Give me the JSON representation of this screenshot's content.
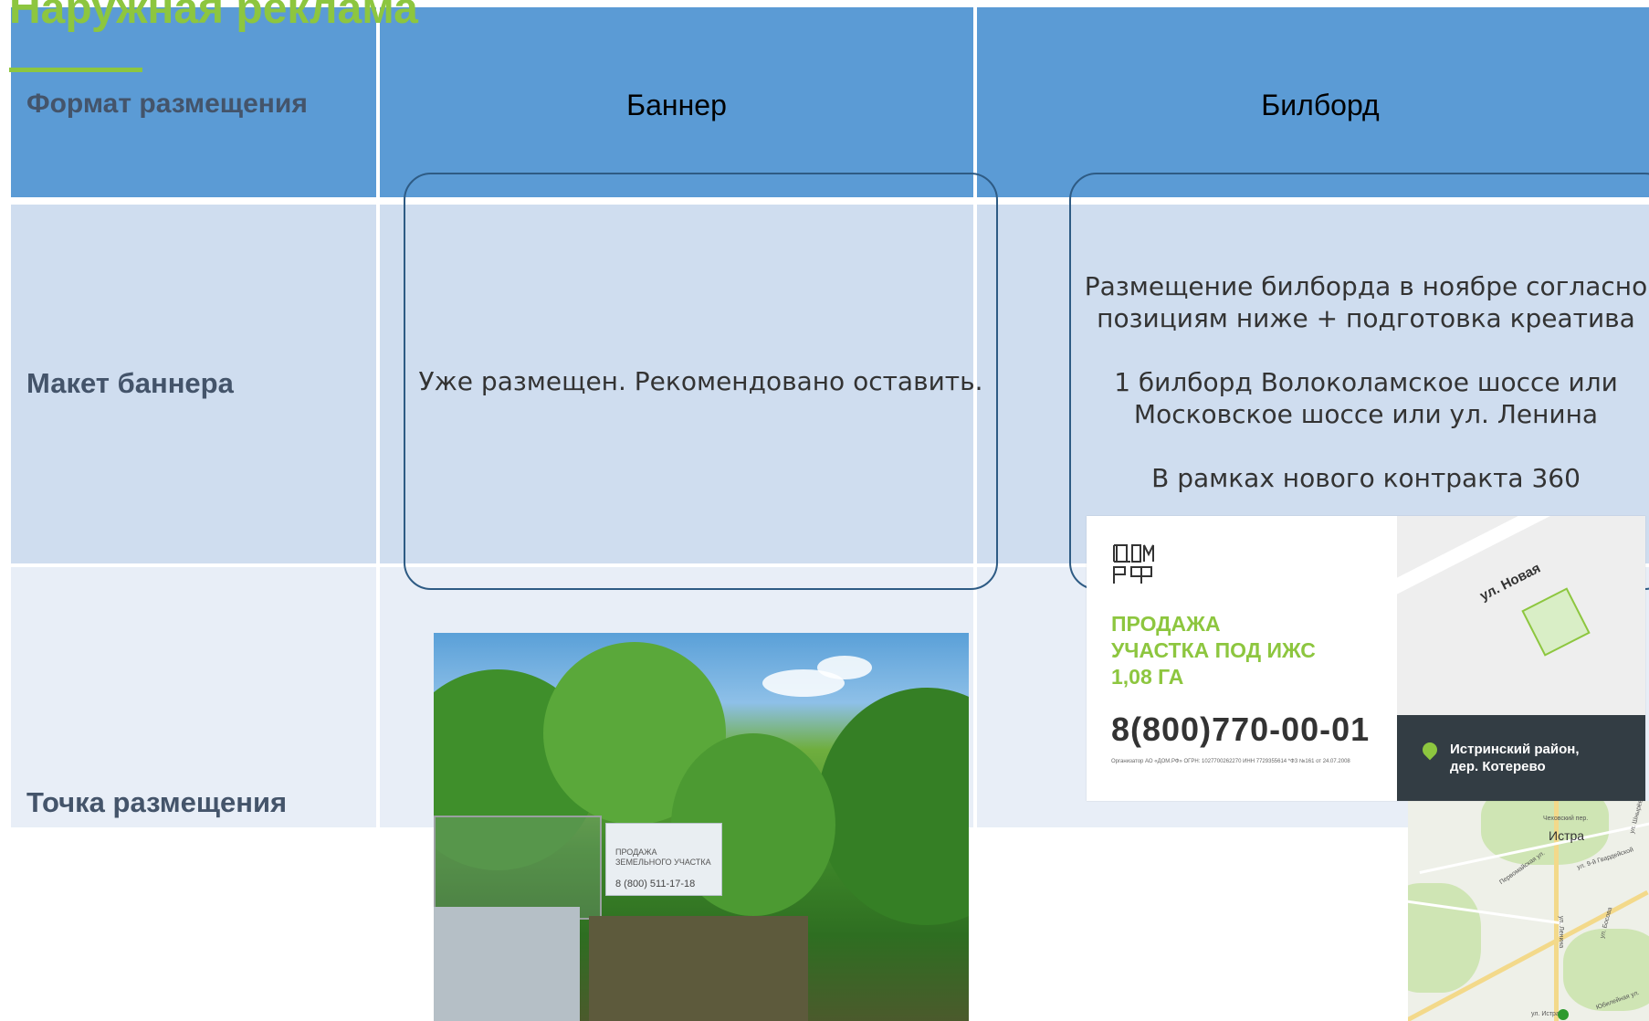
{
  "page": {
    "title": "Наружная реклама"
  },
  "table": {
    "header": {
      "row_label": "Формат размещения",
      "col_banner": "Баннер",
      "col_billboard": "Билборд"
    },
    "rows": {
      "layout_label": "Макет баннера",
      "placement_label": "Точка размещения"
    },
    "banner_note": "Уже размещен. Рекомендовано оставить.",
    "billboard_note": {
      "line1": "Размещение билборда в ноябре согласно",
      "line2": "позициям ниже + подготовка креатива",
      "line3": "1 билборд Волоколамское шоссе или",
      "line4": "Московское шоссе или ул. Ленина",
      "line5": "В рамках нового контракта 360"
    }
  },
  "photo": {
    "sign_line1": "ПРОДАЖА",
    "sign_line2": "ЗЕМЕЛЬНОГО УЧАСТКА",
    "sign_phone": "8 (800) 511-17-18"
  },
  "billboard": {
    "heading_line1": "ПРОДАЖА",
    "heading_line2": "УЧАСТКА ПОД ИЖС",
    "heading_line3": "1,08 ГА",
    "phone": "8(800)770-00-01",
    "fine_print": "Организатор АО «ДОМ.РФ» ОГРН: 1027700262270 ИНН 7729355614 *ФЗ №161 от 24.07.2008",
    "street": "ул. Новая",
    "address_line1": "Истринский район,",
    "address_line2": "дер. Котерево"
  },
  "mini_map": {
    "city": "Истра",
    "streets": [
      "Чеховский пер.",
      "ул. 9-й Гвардейской",
      "ул. Шнырёва",
      "Первомайская ул.",
      "ул. Ленина",
      "ул. Босова",
      "Юбилейная ул.",
      "ул. Истра"
    ],
    "colors": {
      "park": "#cfe5b4",
      "road": "#f3d98a",
      "marker": "#2e9a2e"
    }
  },
  "colors": {
    "accent": "#8dc63f",
    "header_blue": "#5b9bd5",
    "row_light": "#cfddef",
    "row_lighter": "#e8eef7",
    "label_text": "#44546a",
    "frame": "#2e5b84"
  }
}
